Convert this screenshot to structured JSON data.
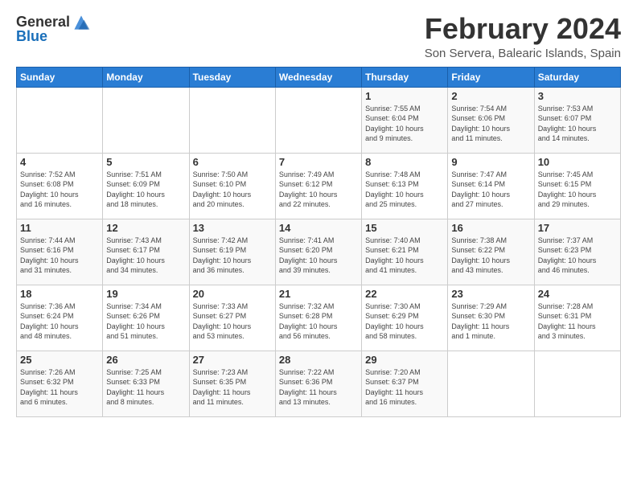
{
  "logo": {
    "general": "General",
    "blue": "Blue"
  },
  "title": "February 2024",
  "subtitle": "Son Servera, Balearic Islands, Spain",
  "headers": [
    "Sunday",
    "Monday",
    "Tuesday",
    "Wednesday",
    "Thursday",
    "Friday",
    "Saturday"
  ],
  "weeks": [
    [
      {
        "day": "",
        "detail": ""
      },
      {
        "day": "",
        "detail": ""
      },
      {
        "day": "",
        "detail": ""
      },
      {
        "day": "",
        "detail": ""
      },
      {
        "day": "1",
        "detail": "Sunrise: 7:55 AM\nSunset: 6:04 PM\nDaylight: 10 hours\nand 9 minutes."
      },
      {
        "day": "2",
        "detail": "Sunrise: 7:54 AM\nSunset: 6:06 PM\nDaylight: 10 hours\nand 11 minutes."
      },
      {
        "day": "3",
        "detail": "Sunrise: 7:53 AM\nSunset: 6:07 PM\nDaylight: 10 hours\nand 14 minutes."
      }
    ],
    [
      {
        "day": "4",
        "detail": "Sunrise: 7:52 AM\nSunset: 6:08 PM\nDaylight: 10 hours\nand 16 minutes."
      },
      {
        "day": "5",
        "detail": "Sunrise: 7:51 AM\nSunset: 6:09 PM\nDaylight: 10 hours\nand 18 minutes."
      },
      {
        "day": "6",
        "detail": "Sunrise: 7:50 AM\nSunset: 6:10 PM\nDaylight: 10 hours\nand 20 minutes."
      },
      {
        "day": "7",
        "detail": "Sunrise: 7:49 AM\nSunset: 6:12 PM\nDaylight: 10 hours\nand 22 minutes."
      },
      {
        "day": "8",
        "detail": "Sunrise: 7:48 AM\nSunset: 6:13 PM\nDaylight: 10 hours\nand 25 minutes."
      },
      {
        "day": "9",
        "detail": "Sunrise: 7:47 AM\nSunset: 6:14 PM\nDaylight: 10 hours\nand 27 minutes."
      },
      {
        "day": "10",
        "detail": "Sunrise: 7:45 AM\nSunset: 6:15 PM\nDaylight: 10 hours\nand 29 minutes."
      }
    ],
    [
      {
        "day": "11",
        "detail": "Sunrise: 7:44 AM\nSunset: 6:16 PM\nDaylight: 10 hours\nand 31 minutes."
      },
      {
        "day": "12",
        "detail": "Sunrise: 7:43 AM\nSunset: 6:17 PM\nDaylight: 10 hours\nand 34 minutes."
      },
      {
        "day": "13",
        "detail": "Sunrise: 7:42 AM\nSunset: 6:19 PM\nDaylight: 10 hours\nand 36 minutes."
      },
      {
        "day": "14",
        "detail": "Sunrise: 7:41 AM\nSunset: 6:20 PM\nDaylight: 10 hours\nand 39 minutes."
      },
      {
        "day": "15",
        "detail": "Sunrise: 7:40 AM\nSunset: 6:21 PM\nDaylight: 10 hours\nand 41 minutes."
      },
      {
        "day": "16",
        "detail": "Sunrise: 7:38 AM\nSunset: 6:22 PM\nDaylight: 10 hours\nand 43 minutes."
      },
      {
        "day": "17",
        "detail": "Sunrise: 7:37 AM\nSunset: 6:23 PM\nDaylight: 10 hours\nand 46 minutes."
      }
    ],
    [
      {
        "day": "18",
        "detail": "Sunrise: 7:36 AM\nSunset: 6:24 PM\nDaylight: 10 hours\nand 48 minutes."
      },
      {
        "day": "19",
        "detail": "Sunrise: 7:34 AM\nSunset: 6:26 PM\nDaylight: 10 hours\nand 51 minutes."
      },
      {
        "day": "20",
        "detail": "Sunrise: 7:33 AM\nSunset: 6:27 PM\nDaylight: 10 hours\nand 53 minutes."
      },
      {
        "day": "21",
        "detail": "Sunrise: 7:32 AM\nSunset: 6:28 PM\nDaylight: 10 hours\nand 56 minutes."
      },
      {
        "day": "22",
        "detail": "Sunrise: 7:30 AM\nSunset: 6:29 PM\nDaylight: 10 hours\nand 58 minutes."
      },
      {
        "day": "23",
        "detail": "Sunrise: 7:29 AM\nSunset: 6:30 PM\nDaylight: 11 hours\nand 1 minute."
      },
      {
        "day": "24",
        "detail": "Sunrise: 7:28 AM\nSunset: 6:31 PM\nDaylight: 11 hours\nand 3 minutes."
      }
    ],
    [
      {
        "day": "25",
        "detail": "Sunrise: 7:26 AM\nSunset: 6:32 PM\nDaylight: 11 hours\nand 6 minutes."
      },
      {
        "day": "26",
        "detail": "Sunrise: 7:25 AM\nSunset: 6:33 PM\nDaylight: 11 hours\nand 8 minutes."
      },
      {
        "day": "27",
        "detail": "Sunrise: 7:23 AM\nSunset: 6:35 PM\nDaylight: 11 hours\nand 11 minutes."
      },
      {
        "day": "28",
        "detail": "Sunrise: 7:22 AM\nSunset: 6:36 PM\nDaylight: 11 hours\nand 13 minutes."
      },
      {
        "day": "29",
        "detail": "Sunrise: 7:20 AM\nSunset: 6:37 PM\nDaylight: 11 hours\nand 16 minutes."
      },
      {
        "day": "",
        "detail": ""
      },
      {
        "day": "",
        "detail": ""
      }
    ]
  ]
}
